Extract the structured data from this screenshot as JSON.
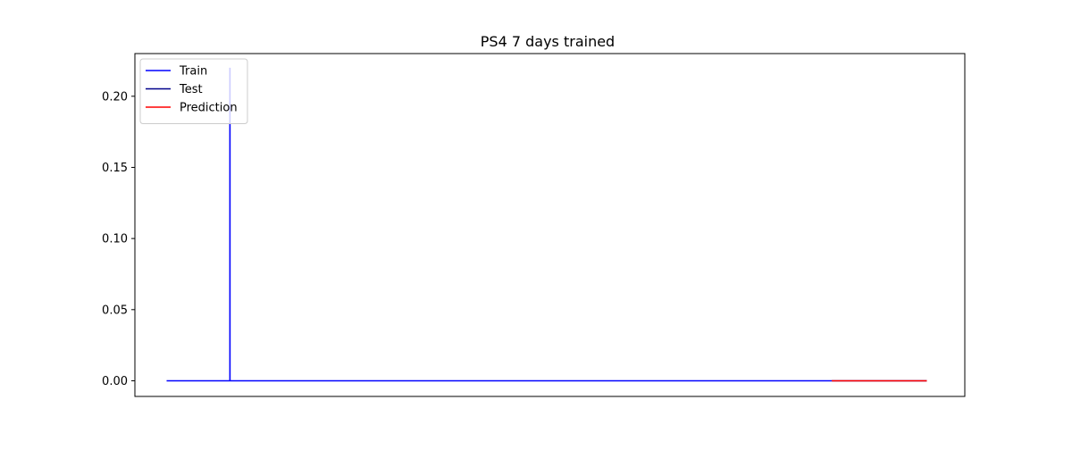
{
  "chart_data": {
    "type": "line",
    "title": "PS4 7 days trained",
    "xlabel": "",
    "ylabel": "",
    "x_ticks_visible": false,
    "xlim": [
      -5,
      126
    ],
    "ylim": [
      -0.011,
      0.23
    ],
    "y_ticks": [
      0.0,
      0.05,
      0.1,
      0.15,
      0.2
    ],
    "y_tick_labels": [
      "0.00",
      "0.05",
      "0.10",
      "0.15",
      "0.20"
    ],
    "grid": false,
    "legend": {
      "placement": "top-left",
      "entries": [
        "Train",
        "Test",
        "Prediction"
      ]
    },
    "series": [
      {
        "name": "Train",
        "color": "#0000ff",
        "x": [
          0,
          10,
          10,
          10,
          105
        ],
        "y": [
          0.0,
          0.0,
          0.22,
          0.0,
          0.0
        ]
      },
      {
        "name": "Test",
        "color": "#00008b",
        "x": [
          105,
          120
        ],
        "y": [
          0.0,
          0.0
        ]
      },
      {
        "name": "Prediction",
        "color": "#ff0000",
        "x": [
          105,
          120
        ],
        "y": [
          0.0,
          0.0
        ]
      }
    ]
  }
}
